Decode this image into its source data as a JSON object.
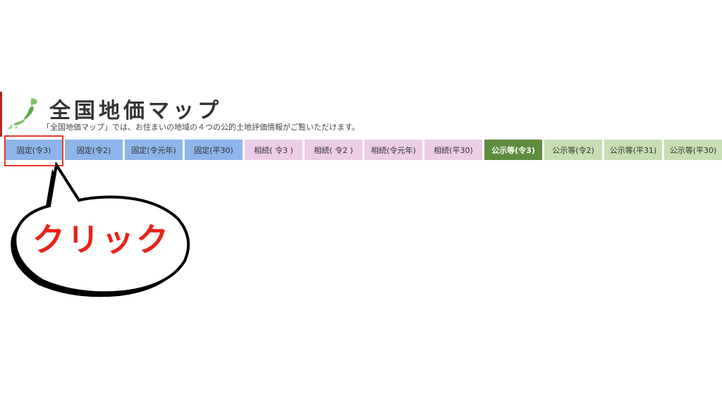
{
  "header": {
    "title": "全国地価マップ",
    "subtitle": "「全国地価マップ」では、お住まいの地域の４つの公的土地評価情報がご覧いただけます。"
  },
  "tabs": [
    {
      "label": "固定(令3)",
      "group": "fixed",
      "active": false
    },
    {
      "label": "固定(令2)",
      "group": "fixed",
      "active": false
    },
    {
      "label": "固定(令元年)",
      "group": "fixed",
      "active": false
    },
    {
      "label": "固定(平30)",
      "group": "fixed",
      "active": false
    },
    {
      "label": "相続( 令3 )",
      "group": "inheritance",
      "active": false
    },
    {
      "label": "相続( 令2 )",
      "group": "inheritance",
      "active": false
    },
    {
      "label": "相続(令元年)",
      "group": "inheritance",
      "active": false
    },
    {
      "label": "相続(平30)",
      "group": "inheritance",
      "active": false
    },
    {
      "label": "公示等(令3)",
      "group": "public",
      "active": true
    },
    {
      "label": "公示等(令2)",
      "group": "public",
      "active": false
    },
    {
      "label": "公示等(平31)",
      "group": "public",
      "active": false
    },
    {
      "label": "公示等(平30)",
      "group": "public",
      "active": false
    }
  ],
  "callout": {
    "label": "クリック"
  },
  "colors": {
    "fixed_tab": "#8db5ea",
    "inheritance_tab": "#ebcde7",
    "public_tab": "#c6deb4",
    "public_tab_active": "#5f8c3f",
    "highlight": "#e33a2f",
    "callout_text": "#e8231a"
  }
}
